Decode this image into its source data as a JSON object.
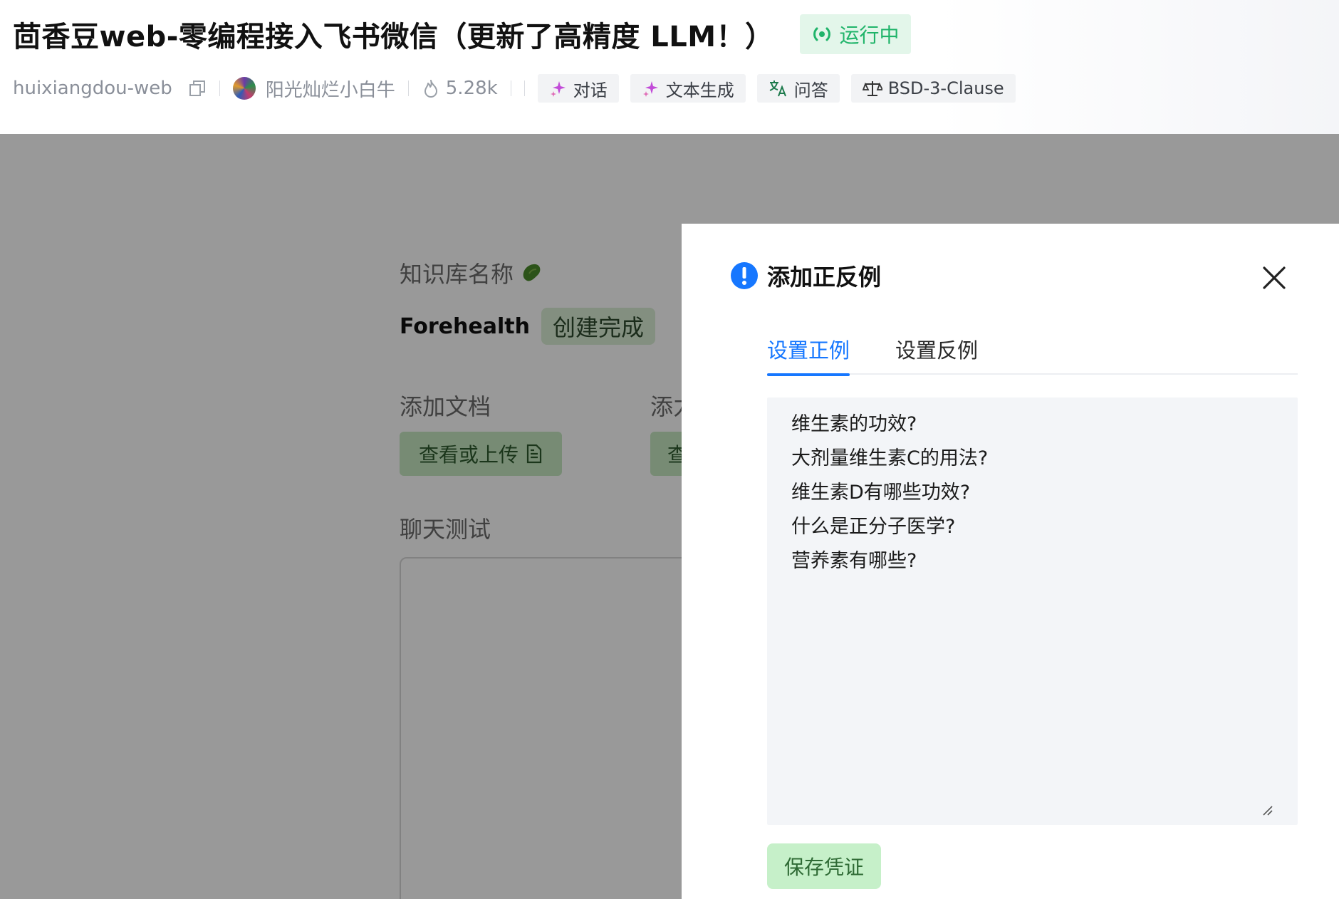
{
  "header": {
    "title": "茴香豆web-零编程接入飞书微信（更新了高精度 LLM！）",
    "status": "运行中",
    "repo_id": "huixiangdou-web",
    "author": "阳光灿烂小白牛",
    "hot_count": "5.28k",
    "tags": [
      {
        "label": "对话",
        "icon": "sparkle-icon"
      },
      {
        "label": "文本生成",
        "icon": "sparkle-icon"
      },
      {
        "label": "问答",
        "icon": "translate-icon"
      },
      {
        "label": "BSD-3-Clause",
        "icon": "scale-icon"
      }
    ]
  },
  "background": {
    "kb_label": "知识库名称",
    "kb_name": "Forehealth",
    "kb_status": "创建完成",
    "add_doc_label": "添加文档",
    "add_doc2_label": "添力",
    "view_upload": "查看或上传",
    "view_upload2": "查",
    "chat_test_label": "聊天测试"
  },
  "drawer": {
    "title": "添加正反例",
    "tabs": [
      {
        "label": "设置正例",
        "active": true
      },
      {
        "label": "设置反例",
        "active": false
      }
    ],
    "textarea_lines": [
      "维生素的功效?",
      "大剂量维生素C的用法?",
      "维生素D有哪些功效?",
      "什么是正分子医学?",
      "营养素有哪些?"
    ],
    "save_label": "保存凭证"
  },
  "colors": {
    "accent": "#1677ff",
    "status_green": "#20b46a",
    "save_green": "#c6f0c9"
  }
}
